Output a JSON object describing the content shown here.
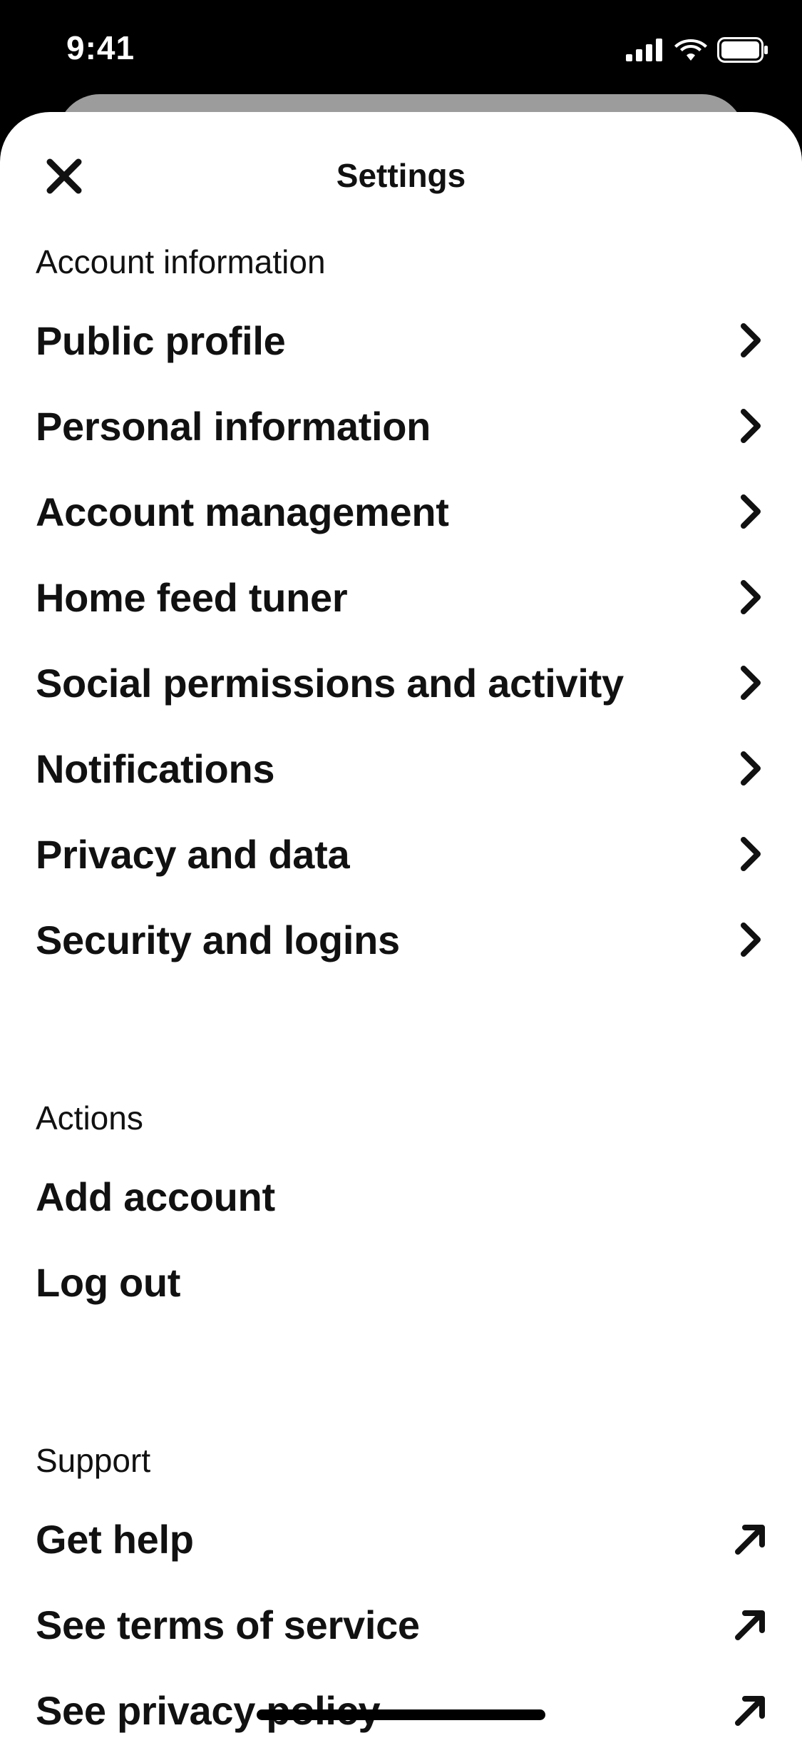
{
  "status_bar": {
    "time": "9:41"
  },
  "header": {
    "title": "Settings",
    "close_icon": "close-icon"
  },
  "sections": [
    {
      "title": "Account information",
      "items": [
        {
          "label": "Public profile",
          "icon": "chevron-right-icon"
        },
        {
          "label": "Personal information",
          "icon": "chevron-right-icon"
        },
        {
          "label": "Account management",
          "icon": "chevron-right-icon"
        },
        {
          "label": "Home feed tuner",
          "icon": "chevron-right-icon"
        },
        {
          "label": "Social permissions and activity",
          "icon": "chevron-right-icon"
        },
        {
          "label": "Notifications",
          "icon": "chevron-right-icon"
        },
        {
          "label": "Privacy and data",
          "icon": "chevron-right-icon"
        },
        {
          "label": "Security and logins",
          "icon": "chevron-right-icon"
        }
      ]
    },
    {
      "title": "Actions",
      "items": [
        {
          "label": "Add account"
        },
        {
          "label": "Log out"
        }
      ]
    },
    {
      "title": "Support",
      "items": [
        {
          "label": "Get help",
          "icon": "external-arrow-icon"
        },
        {
          "label": "See terms of service",
          "icon": "external-arrow-icon"
        },
        {
          "label": "See privacy policy",
          "icon": "external-arrow-icon"
        }
      ]
    }
  ],
  "colors": {
    "background": "#000000",
    "sheet": "#ffffff",
    "text": "#111111",
    "back_sheet": "#9c9c9c"
  }
}
